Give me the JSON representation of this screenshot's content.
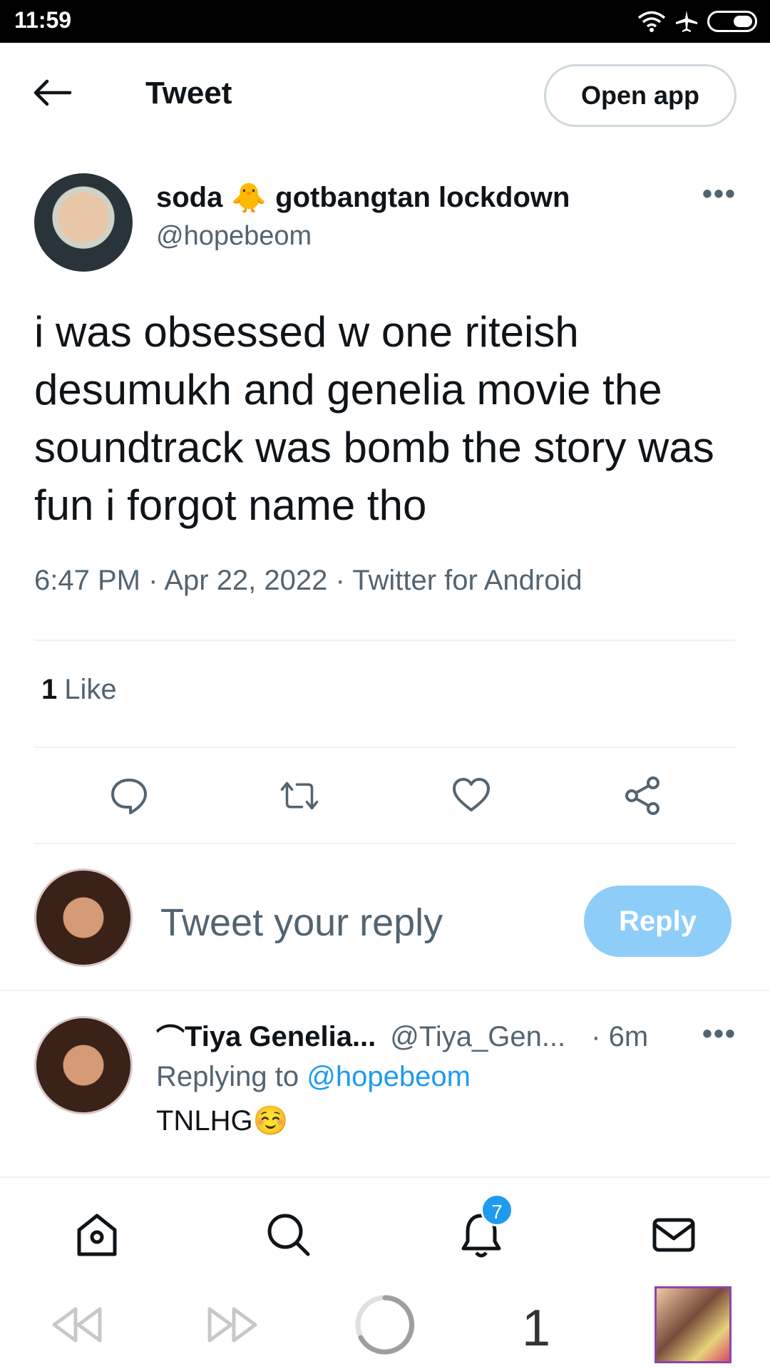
{
  "status_bar": {
    "time": "11:59"
  },
  "header": {
    "title": "Tweet",
    "open_app_label": "Open app"
  },
  "tweet": {
    "author_name": "soda",
    "author_emoji": "🐥",
    "author_name_suffix": "gotbangtan lockdown",
    "author_handle": "@hopebeom",
    "text": "i was obsessed w one riteish desumukh and genelia movie the soundtrack was bomb the story was fun i forgot name tho",
    "time": "6:47 PM",
    "date": "Apr 22, 2022",
    "source": "Twitter for Android",
    "meta_separator": "·",
    "like_count": "1",
    "like_label": "Like"
  },
  "reply_composer": {
    "placeholder": "Tweet your reply",
    "button_label": "Reply"
  },
  "reply": {
    "name_prefix": "⌒",
    "name": "Tiya Genelia...",
    "handle": "@Tiya_Gen...",
    "time": "· 6m",
    "replying_label": "Replying to",
    "replying_mention": "@hopebeom",
    "text": "TNLHG☺️"
  },
  "tab_bar": {
    "notifications_badge": "7"
  },
  "browser": {
    "tab_count": "1"
  },
  "colors": {
    "accent": "#1d9bf0",
    "reply_button": "#8ecdf8",
    "secondary_text": "#536471"
  },
  "icons": [
    "arrow-left-icon",
    "wifi-icon",
    "airplane-icon",
    "battery-icon",
    "more-icon",
    "comment-icon",
    "retweet-icon",
    "heart-icon",
    "share-icon",
    "home-icon",
    "search-icon",
    "bell-icon",
    "mail-icon",
    "rewind-icon",
    "forward-icon",
    "loading-icon"
  ]
}
